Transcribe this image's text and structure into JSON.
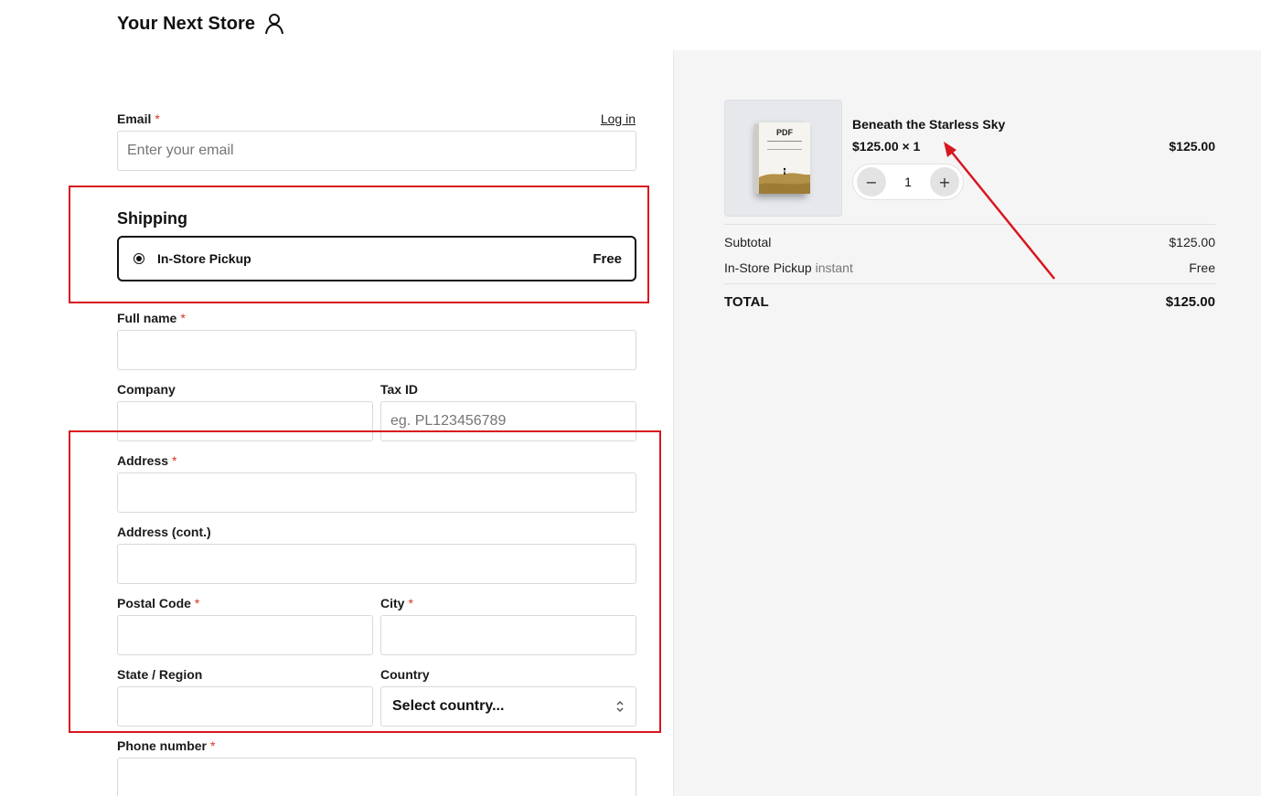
{
  "header": {
    "store_name": "Your Next Store"
  },
  "form": {
    "email": {
      "label": "Email",
      "placeholder": "Enter your email",
      "login_link": "Log in"
    },
    "shipping": {
      "title": "Shipping",
      "option_label": "In-Store Pickup",
      "option_price": "Free"
    },
    "full_name": {
      "label": "Full name"
    },
    "company": {
      "label": "Company"
    },
    "tax_id": {
      "label": "Tax ID",
      "placeholder": "eg. PL123456789"
    },
    "address": {
      "label": "Address"
    },
    "address_cont": {
      "label": "Address (cont.)"
    },
    "postal_code": {
      "label": "Postal Code"
    },
    "city": {
      "label": "City"
    },
    "state": {
      "label": "State / Region"
    },
    "country": {
      "label": "Country",
      "selected": "Select country..."
    },
    "phone": {
      "label": "Phone number"
    },
    "required_mark": "*"
  },
  "summary": {
    "item": {
      "name": "Beneath the Starless Sky",
      "price_qty": "$125.00 × 1",
      "line_total": "$125.00",
      "quantity": "1",
      "thumbnail_label": "PDF"
    },
    "subtotal_label": "Subtotal",
    "subtotal_value": "$125.00",
    "shipping_label": "In-Store Pickup",
    "shipping_note": "instant",
    "shipping_value": "Free",
    "total_label": "TOTAL",
    "total_value": "$125.00"
  },
  "colors": {
    "annotation": "#d8171e",
    "required": "#d93025",
    "summary_bg": "#f5f5f5"
  }
}
